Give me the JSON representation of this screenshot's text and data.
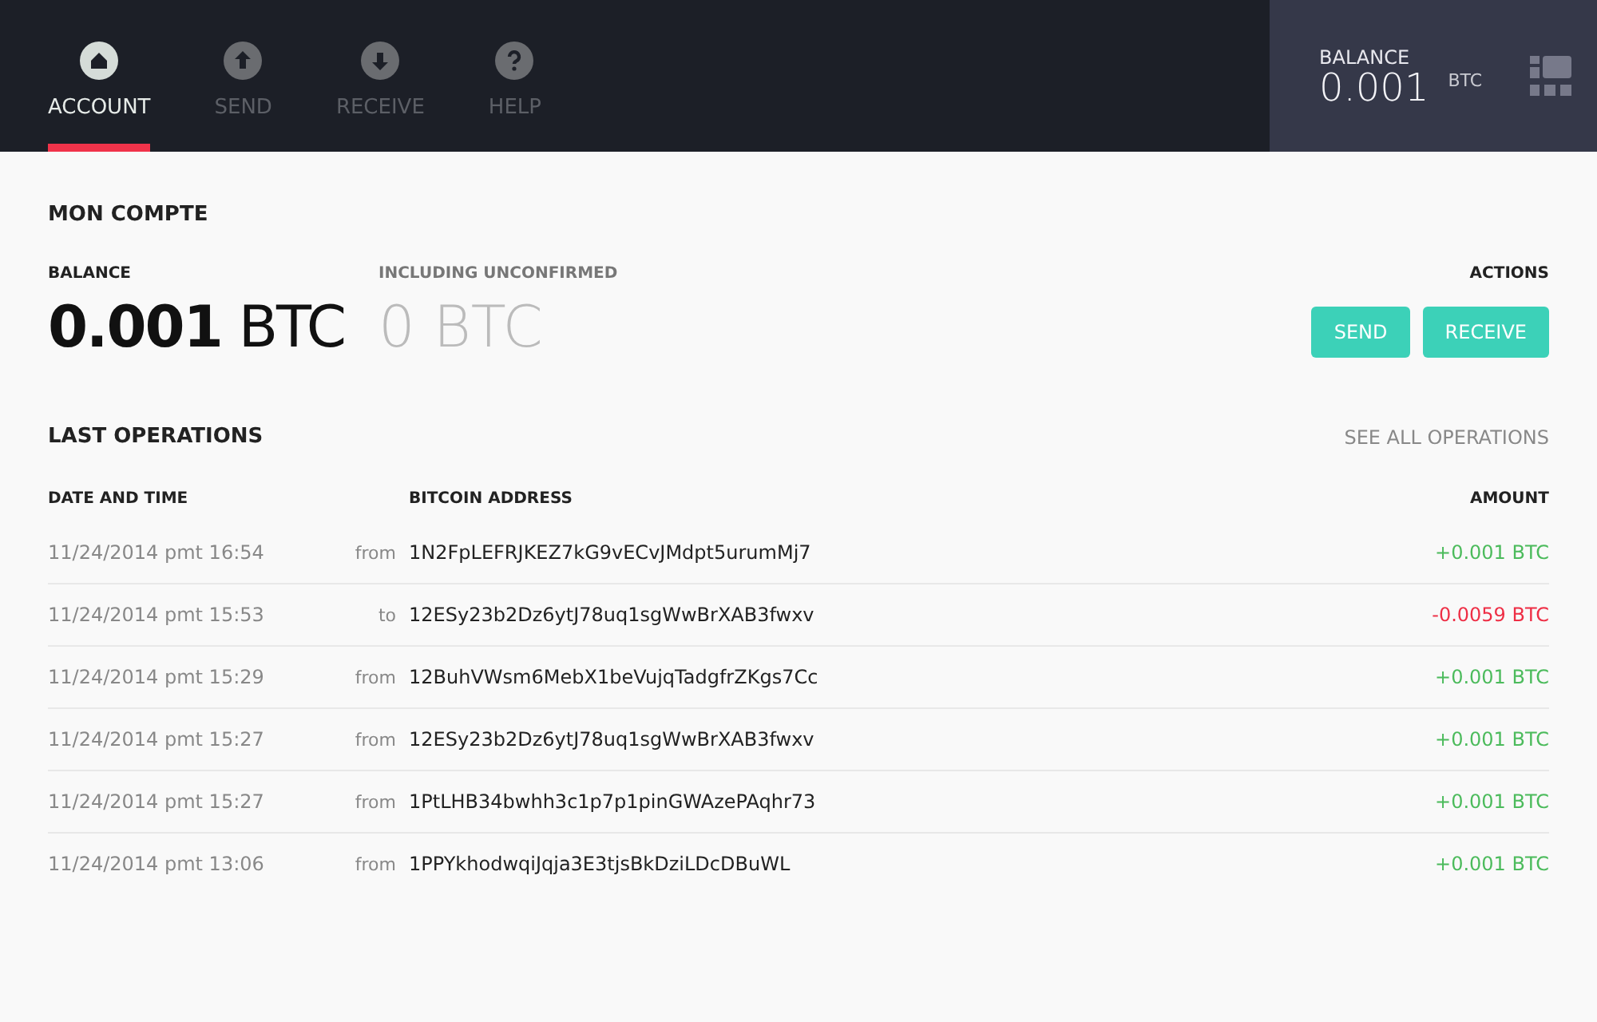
{
  "nav": {
    "tabs": [
      {
        "label": "ACCOUNT",
        "selected": true
      },
      {
        "label": "SEND",
        "selected": false
      },
      {
        "label": "RECEIVE",
        "selected": false
      },
      {
        "label": "HELP",
        "selected": false
      }
    ]
  },
  "header_balance": {
    "label": "BALANCE",
    "value": "0.001",
    "unit": "BTC"
  },
  "account": {
    "title": "MON COMPTE",
    "balance": {
      "label": "BALANCE",
      "value": "0.001",
      "unit": "BTC"
    },
    "unconfirmed": {
      "label": "INCLUDING UNCONFIRMED",
      "value": "0 BTC"
    },
    "actions": {
      "label": "ACTIONS",
      "buttons": [
        "SEND",
        "RECEIVE"
      ]
    }
  },
  "operations": {
    "title": "LAST OPERATIONS",
    "see_all": "SEE ALL OPERATIONS",
    "columns": [
      "DATE AND TIME",
      "BITCOIN ADDRESS",
      "AMOUNT"
    ],
    "rows": [
      {
        "date": "11/24/2014 pmt 16:54",
        "direction": "from",
        "address": "1N2FpLEFRJKEZ7kG9vECvJMdpt5urumMj7",
        "amount": "+0.001 BTC",
        "kind": "incoming"
      },
      {
        "date": "11/24/2014 pmt 15:53",
        "direction": "to",
        "address": "12ESy23b2Dz6ytJ78uq1sgWwBrXAB3fwxv",
        "amount": "-0.0059 BTC",
        "kind": "outgoing"
      },
      {
        "date": "11/24/2014 pmt 15:29",
        "direction": "from",
        "address": "12BuhVWsm6MebX1beVujqTadgfrZKgs7Cc",
        "amount": "+0.001 BTC",
        "kind": "incoming"
      },
      {
        "date": "11/24/2014 pmt 15:27",
        "direction": "from",
        "address": "12ESy23b2Dz6ytJ78uq1sgWwBrXAB3fwxv",
        "amount": "+0.001 BTC",
        "kind": "incoming"
      },
      {
        "date": "11/24/2014 pmt 15:27",
        "direction": "from",
        "address": "1PtLHB34bwhh3c1p7p1pinGWAzePAqhr73",
        "amount": "+0.001 BTC",
        "kind": "incoming"
      },
      {
        "date": "11/24/2014 pmt 13:06",
        "direction": "from",
        "address": "1PPYkhodwqiJqja3E3tjsBkDziLDcDBuWL",
        "amount": "+0.001 BTC",
        "kind": "incoming"
      }
    ]
  }
}
